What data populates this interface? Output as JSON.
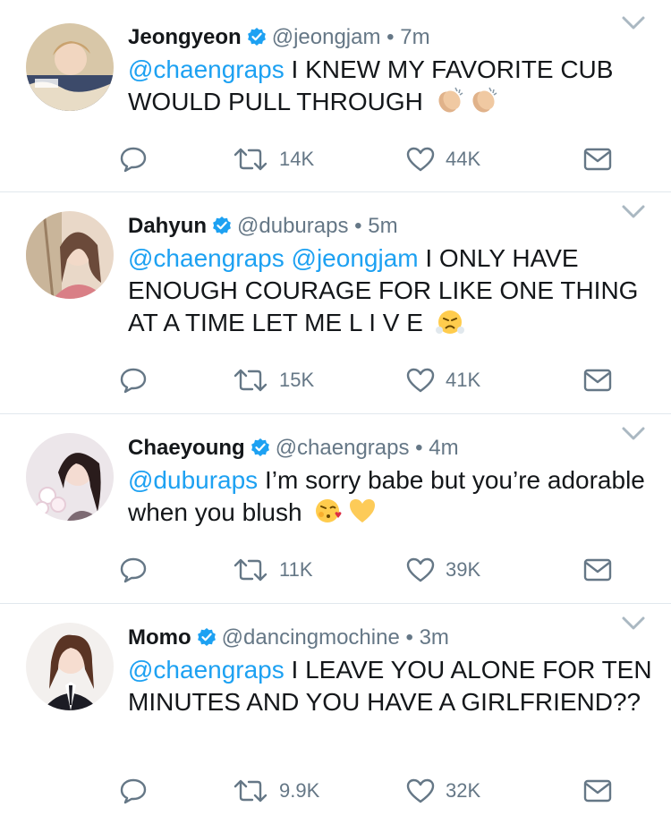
{
  "colors": {
    "accent": "#1da1f2",
    "muted": "#657786",
    "text": "#14171a",
    "divider": "#e1e8ed"
  },
  "tweets": [
    {
      "name": "Jeongyeon",
      "handle": "@jeongjam",
      "dot": "•",
      "time": "7m",
      "mentions": "@chaengraps",
      "body": " I KNEW MY FAVORITE CUB WOULD PULL THROUGH",
      "emojis": [
        "clapping-hands",
        "clapping-hands"
      ],
      "replies": "",
      "retweets": "14K",
      "likes": "44K"
    },
    {
      "name": "Dahyun",
      "handle": "@duburaps",
      "dot": "•",
      "time": "5m",
      "mentions": "@chaengraps @jeongjam",
      "body": " I ONLY HAVE ENOUGH COURAGE FOR LIKE ONE THING AT A TIME LET ME L I V E",
      "emojis": [
        "face-with-steam"
      ],
      "replies": "",
      "retweets": "15K",
      "likes": "41K"
    },
    {
      "name": "Chaeyoung",
      "handle": "@chaengraps",
      "dot": "•",
      "time": "4m",
      "mentions": "@duburaps",
      "body": " I’m sorry babe but you’re adorable when you blush",
      "emojis": [
        "face-blowing-kiss",
        "yellow-heart"
      ],
      "replies": "",
      "retweets": "11K",
      "likes": "39K"
    },
    {
      "name": "Momo",
      "handle": "@dancingmochine",
      "dot": "•",
      "time": "3m",
      "mentions": "@chaengraps",
      "body": " I LEAVE YOU ALONE FOR TEN MINUTES AND YOU HAVE A GIRLFRIEND??",
      "emojis": [],
      "replies": "",
      "retweets": "9.9K",
      "likes": "32K"
    }
  ]
}
